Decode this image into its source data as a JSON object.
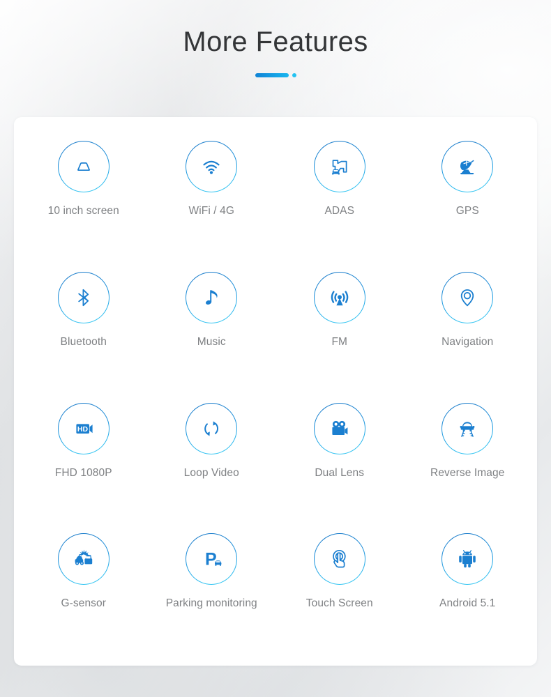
{
  "header": {
    "title": "More Features",
    "accent_start": "#1083d6",
    "accent_end": "#18b6ef",
    "dot_color": "#23c2f2"
  },
  "card": {
    "background": "#ffffff",
    "label_color": "#7e8083",
    "icon_color": "#1b7fd0"
  },
  "features": [
    {
      "label": "10 inch screen",
      "icon": "screen-icon"
    },
    {
      "label": "WiFi / 4G",
      "icon": "wifi-icon"
    },
    {
      "label": "ADAS",
      "icon": "adas-lane-car-icon"
    },
    {
      "label": "GPS",
      "icon": "satellite-dish-icon"
    },
    {
      "label": "Bluetooth",
      "icon": "bluetooth-icon"
    },
    {
      "label": "Music",
      "icon": "music-note-icon"
    },
    {
      "label": "FM",
      "icon": "radio-broadcast-icon"
    },
    {
      "label": "Navigation",
      "icon": "map-pin-icon"
    },
    {
      "label": "FHD 1080P",
      "icon": "hd-camera-icon"
    },
    {
      "label": "Loop Video",
      "icon": "loop-arrows-icon"
    },
    {
      "label": "Dual Lens",
      "icon": "dual-lens-camera-icon"
    },
    {
      "label": "Reverse Image",
      "icon": "reverse-car-icon"
    },
    {
      "label": "G-sensor",
      "icon": "car-crash-icon"
    },
    {
      "label": "Parking monitoring",
      "icon": "parking-p-car-icon"
    },
    {
      "label": "Touch Screen",
      "icon": "touch-hand-icon"
    },
    {
      "label": "Android 5.1",
      "icon": "android-robot-icon"
    }
  ]
}
